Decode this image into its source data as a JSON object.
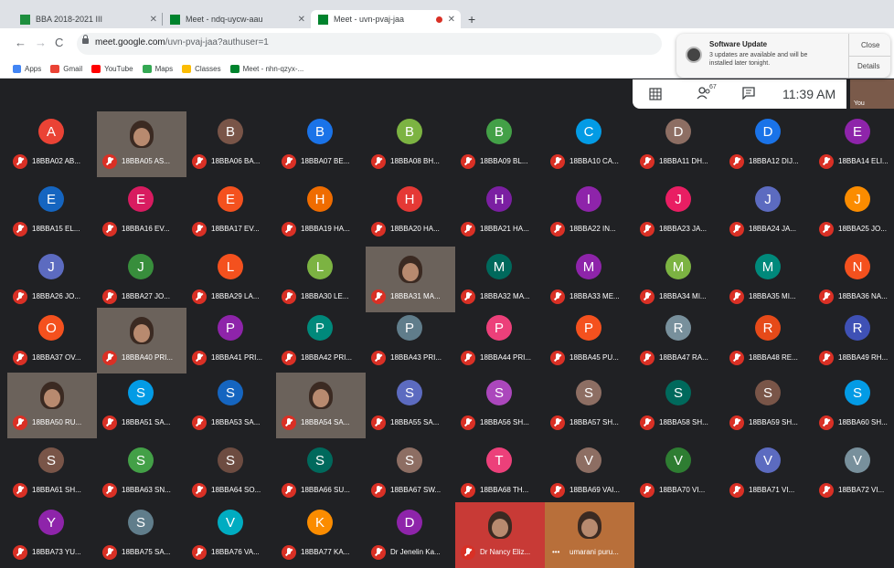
{
  "browser": {
    "tabs": [
      {
        "title": "BBA 2018-2021 III",
        "favicon": "classroom",
        "active": false
      },
      {
        "title": "Meet - ndq-uycw-aau",
        "favicon": "meet",
        "active": false
      },
      {
        "title": "Meet - uvn-pvaj-jaa",
        "favicon": "meet",
        "active": true,
        "recording": true
      }
    ],
    "new_tab": "+",
    "nav": {
      "back": "←",
      "forward": "→",
      "reload": "C"
    },
    "url_host": "meet.google.com",
    "url_path": "/uvn-pvaj-jaa?authuser=1",
    "bookmarks": [
      "Apps",
      "Gmail",
      "YouTube",
      "Maps",
      "Classes",
      "Meet - nhn-qzyx-..."
    ]
  },
  "notification": {
    "title": "Software Update",
    "body": "3 updates are available and will be installed later tonight.",
    "close": "Close",
    "details": "Details"
  },
  "meet": {
    "participant_count": "67",
    "time": "11:39 AM",
    "self_label": "You",
    "tiles": [
      [
        {
          "initial": "A",
          "name": "18BBA02 AB...",
          "color": "#ea4335"
        },
        {
          "video": true,
          "name": "18BBA05 AS..."
        },
        {
          "initial": "B",
          "name": "18BBA06 BA...",
          "color": "#795548"
        },
        {
          "initial": "B",
          "name": "18BBA07 BE...",
          "color": "#1a73e8"
        },
        {
          "initial": "B",
          "name": "18BBA08 BH...",
          "color": "#7cb342"
        },
        {
          "initial": "B",
          "name": "18BBA09 BL...",
          "color": "#43a047"
        },
        {
          "initial": "C",
          "name": "18BBA10 CA...",
          "color": "#039be5"
        },
        {
          "initial": "D",
          "name": "18BBA11 DH...",
          "color": "#8d6e63"
        },
        {
          "initial": "D",
          "name": "18BBA12 DIJ...",
          "color": "#1a73e8"
        },
        {
          "initial": "E",
          "name": "18BBA14 ELI...",
          "color": "#8e24aa"
        }
      ],
      [
        {
          "initial": "E",
          "name": "18BBA15 EL...",
          "color": "#1565c0"
        },
        {
          "initial": "E",
          "name": "18BBA16 EV...",
          "color": "#d81b60"
        },
        {
          "initial": "E",
          "name": "18BBA17 EV...",
          "color": "#f4511e"
        },
        {
          "initial": "H",
          "name": "18BBA19 HA...",
          "color": "#ef6c00"
        },
        {
          "initial": "H",
          "name": "18BBA20 HA...",
          "color": "#e53935"
        },
        {
          "initial": "H",
          "name": "18BBA21 HA...",
          "color": "#7b1fa2"
        },
        {
          "initial": "I",
          "name": "18BBA22 IN...",
          "color": "#8e24aa"
        },
        {
          "initial": "J",
          "name": "18BBA23 JA...",
          "color": "#e91e63"
        },
        {
          "initial": "J",
          "name": "18BBA24 JA...",
          "color": "#5c6bc0"
        },
        {
          "initial": "J",
          "name": "18BBA25 JO...",
          "color": "#fb8c00"
        }
      ],
      [
        {
          "initial": "J",
          "name": "18BBA26 JO...",
          "color": "#5c6bc0"
        },
        {
          "initial": "J",
          "name": "18BBA27 JO...",
          "color": "#388e3c"
        },
        {
          "initial": "L",
          "name": "18BBA29 LA...",
          "color": "#f4511e"
        },
        {
          "initial": "L",
          "name": "18BBA30 LE...",
          "color": "#7cb342"
        },
        {
          "video": true,
          "name": "18BBA31 MA..."
        },
        {
          "initial": "M",
          "name": "18BBA32 MA...",
          "color": "#00695c"
        },
        {
          "initial": "M",
          "name": "18BBA33 ME...",
          "color": "#8e24aa"
        },
        {
          "initial": "M",
          "name": "18BBA34 MI...",
          "color": "#7cb342"
        },
        {
          "initial": "M",
          "name": "18BBA35 MI...",
          "color": "#00897b"
        },
        {
          "initial": "N",
          "name": "18BBA36 NA...",
          "color": "#f4511e"
        }
      ],
      [
        {
          "initial": "O",
          "name": "18BBA37 OV...",
          "color": "#f4511e"
        },
        {
          "video": true,
          "name": "18BBA40 PRI..."
        },
        {
          "initial": "P",
          "name": "18BBA41 PRI...",
          "color": "#8e24aa"
        },
        {
          "initial": "P",
          "name": "18BBA42 PRI...",
          "color": "#00897b"
        },
        {
          "initial": "P",
          "name": "18BBA43 PRI...",
          "color": "#607d8b"
        },
        {
          "initial": "P",
          "name": "18BBA44 PRI...",
          "color": "#ec407a"
        },
        {
          "initial": "P",
          "name": "18BBA45 PU...",
          "color": "#f4511e"
        },
        {
          "initial": "R",
          "name": "18BBA47 RA...",
          "color": "#78909c"
        },
        {
          "initial": "R",
          "name": "18BBA48 RE...",
          "color": "#e64a19"
        },
        {
          "initial": "R",
          "name": "18BBA49 RH...",
          "color": "#3f51b5"
        }
      ],
      [
        {
          "video": true,
          "name": "18BBA50 RU..."
        },
        {
          "initial": "S",
          "name": "18BBA51 SA...",
          "color": "#039be5"
        },
        {
          "initial": "S",
          "name": "18BBA53 SA...",
          "color": "#1565c0"
        },
        {
          "video": true,
          "name": "18BBA54 SA..."
        },
        {
          "initial": "S",
          "name": "18BBA55 SA...",
          "color": "#5c6bc0"
        },
        {
          "initial": "S",
          "name": "18BBA56 SH...",
          "color": "#ab47bc"
        },
        {
          "initial": "S",
          "name": "18BBA57 SH...",
          "color": "#8d6e63"
        },
        {
          "initial": "S",
          "name": "18BBA58 SH...",
          "color": "#00695c"
        },
        {
          "initial": "S",
          "name": "18BBA59 SH...",
          "color": "#795548"
        },
        {
          "initial": "S",
          "name": "18BBA60 SH...",
          "color": "#039be5"
        }
      ],
      [
        {
          "initial": "S",
          "name": "18BBA61 SH...",
          "color": "#795548"
        },
        {
          "initial": "S",
          "name": "18BBA63 SN...",
          "color": "#43a047"
        },
        {
          "initial": "S",
          "name": "18BBA64 SO...",
          "color": "#6d4c41"
        },
        {
          "initial": "S",
          "name": "18BBA66 SU...",
          "color": "#00695c"
        },
        {
          "initial": "S",
          "name": "18BBA67 SW...",
          "color": "#8d6e63"
        },
        {
          "initial": "T",
          "name": "18BBA68 TH...",
          "color": "#ec407a"
        },
        {
          "initial": "V",
          "name": "18BBA69 VAI...",
          "color": "#8d6e63"
        },
        {
          "initial": "V",
          "name": "18BBA70 VI...",
          "color": "#2e7d32"
        },
        {
          "initial": "V",
          "name": "18BBA71 VI...",
          "color": "#5c6bc0"
        },
        {
          "initial": "V",
          "name": "18BBA72 VI...",
          "color": "#78909c"
        }
      ],
      [
        {
          "initial": "Y",
          "name": "18BBA73 YU...",
          "color": "#8e24aa"
        },
        {
          "initial": "S",
          "name": "18BBA75 SA...",
          "color": "#607d8b"
        },
        {
          "initial": "V",
          "name": "18BBA76 VA...",
          "color": "#00acc1"
        },
        {
          "initial": "K",
          "name": "18BBA77 KA...",
          "color": "#fb8c00"
        },
        {
          "initial": "D",
          "name": "Dr Jenelin Ka...",
          "color": "#8e24aa"
        },
        {
          "video": true,
          "name": "Dr Nancy Eliz...",
          "bg": "#c83a36"
        },
        {
          "video": true,
          "name": "umarani puru...",
          "bg": "#b86f3a",
          "more": true
        }
      ]
    ]
  }
}
